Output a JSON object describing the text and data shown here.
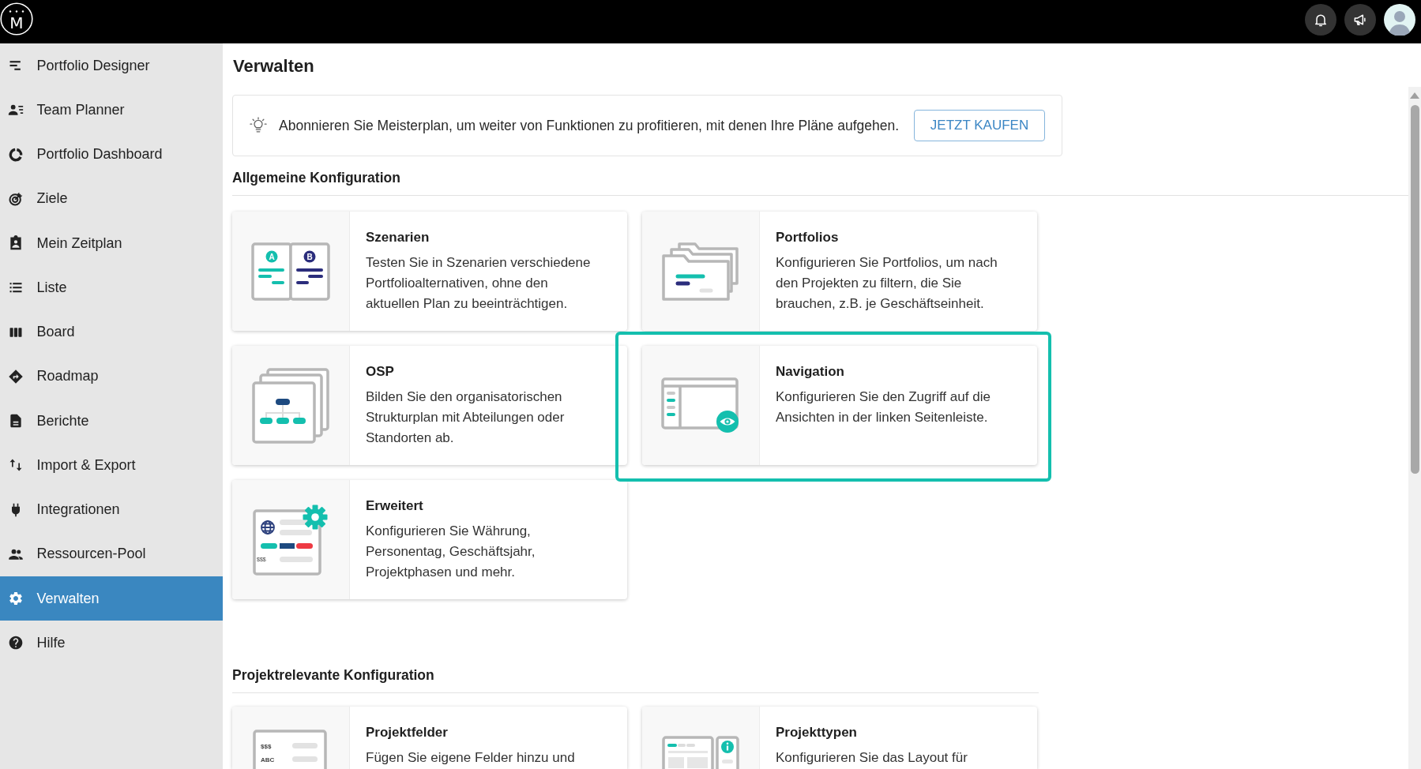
{
  "topbar": {
    "logo_letter": "M"
  },
  "sidebar": {
    "items": [
      {
        "label": "Portfolio Designer",
        "selected": false
      },
      {
        "label": "Team Planner",
        "selected": false
      },
      {
        "label": "Portfolio Dashboard",
        "selected": false
      },
      {
        "label": "Ziele",
        "selected": false
      },
      {
        "label": "Mein Zeitplan",
        "selected": false
      },
      {
        "label": "Liste",
        "selected": false
      },
      {
        "label": "Board",
        "selected": false
      },
      {
        "label": "Roadmap",
        "selected": false
      },
      {
        "label": "Berichte",
        "selected": false
      },
      {
        "label": "Import & Export",
        "selected": false
      },
      {
        "label": "Integrationen",
        "selected": false
      },
      {
        "label": "Ressourcen-Pool",
        "selected": false
      },
      {
        "label": "Verwalten",
        "selected": true
      },
      {
        "label": "Hilfe",
        "selected": false
      }
    ]
  },
  "page": {
    "title": "Verwalten"
  },
  "banner": {
    "text": "Abonnieren Sie Meisterplan, um weiter von Funktionen zu profitieren, mit denen Ihre Pläne aufgehen.",
    "button": "JETZT KAUFEN"
  },
  "sections": [
    {
      "title": "Allgemeine Konfiguration",
      "cards": [
        {
          "title": "Szenarien",
          "description": "Testen Sie in Szenarien verschiedene Portfolioalternativen, ohne den aktuellen Plan zu beeinträchtigen.",
          "icon_texts": [
            "A",
            "B"
          ],
          "highlighted": false
        },
        {
          "title": "Portfolios",
          "description": "Konfigurieren Sie Portfolios, um nach den Projekten zu filtern, die Sie brauchen, z.B. je Geschäftseinheit.",
          "highlighted": false
        },
        {
          "title": "OSP",
          "description": "Bilden Sie den organisatorischen Strukturplan mit Abteilungen oder Standorten ab.",
          "highlighted": false
        },
        {
          "title": "Navigation",
          "description": "Konfigurieren Sie den Zugriff auf die Ansichten in der linken Seitenleiste.",
          "highlighted": true
        },
        {
          "title": "Erweitert",
          "description": "Konfigurieren Sie Währung, Personentag, Geschäftsjahr, Projektphasen und mehr.",
          "icon_texts": [
            "$$$"
          ],
          "highlighted": false
        }
      ]
    },
    {
      "title": "Projektrelevante Konfiguration",
      "cards": [
        {
          "title": "Projektfelder",
          "description": "Fügen Sie eigene Felder hinzu und",
          "icon_texts": [
            "$$$",
            "ABC"
          ],
          "highlighted": false
        },
        {
          "title": "Projekttypen",
          "description": "Konfigurieren Sie das Layout für",
          "highlighted": false
        }
      ]
    }
  ]
}
